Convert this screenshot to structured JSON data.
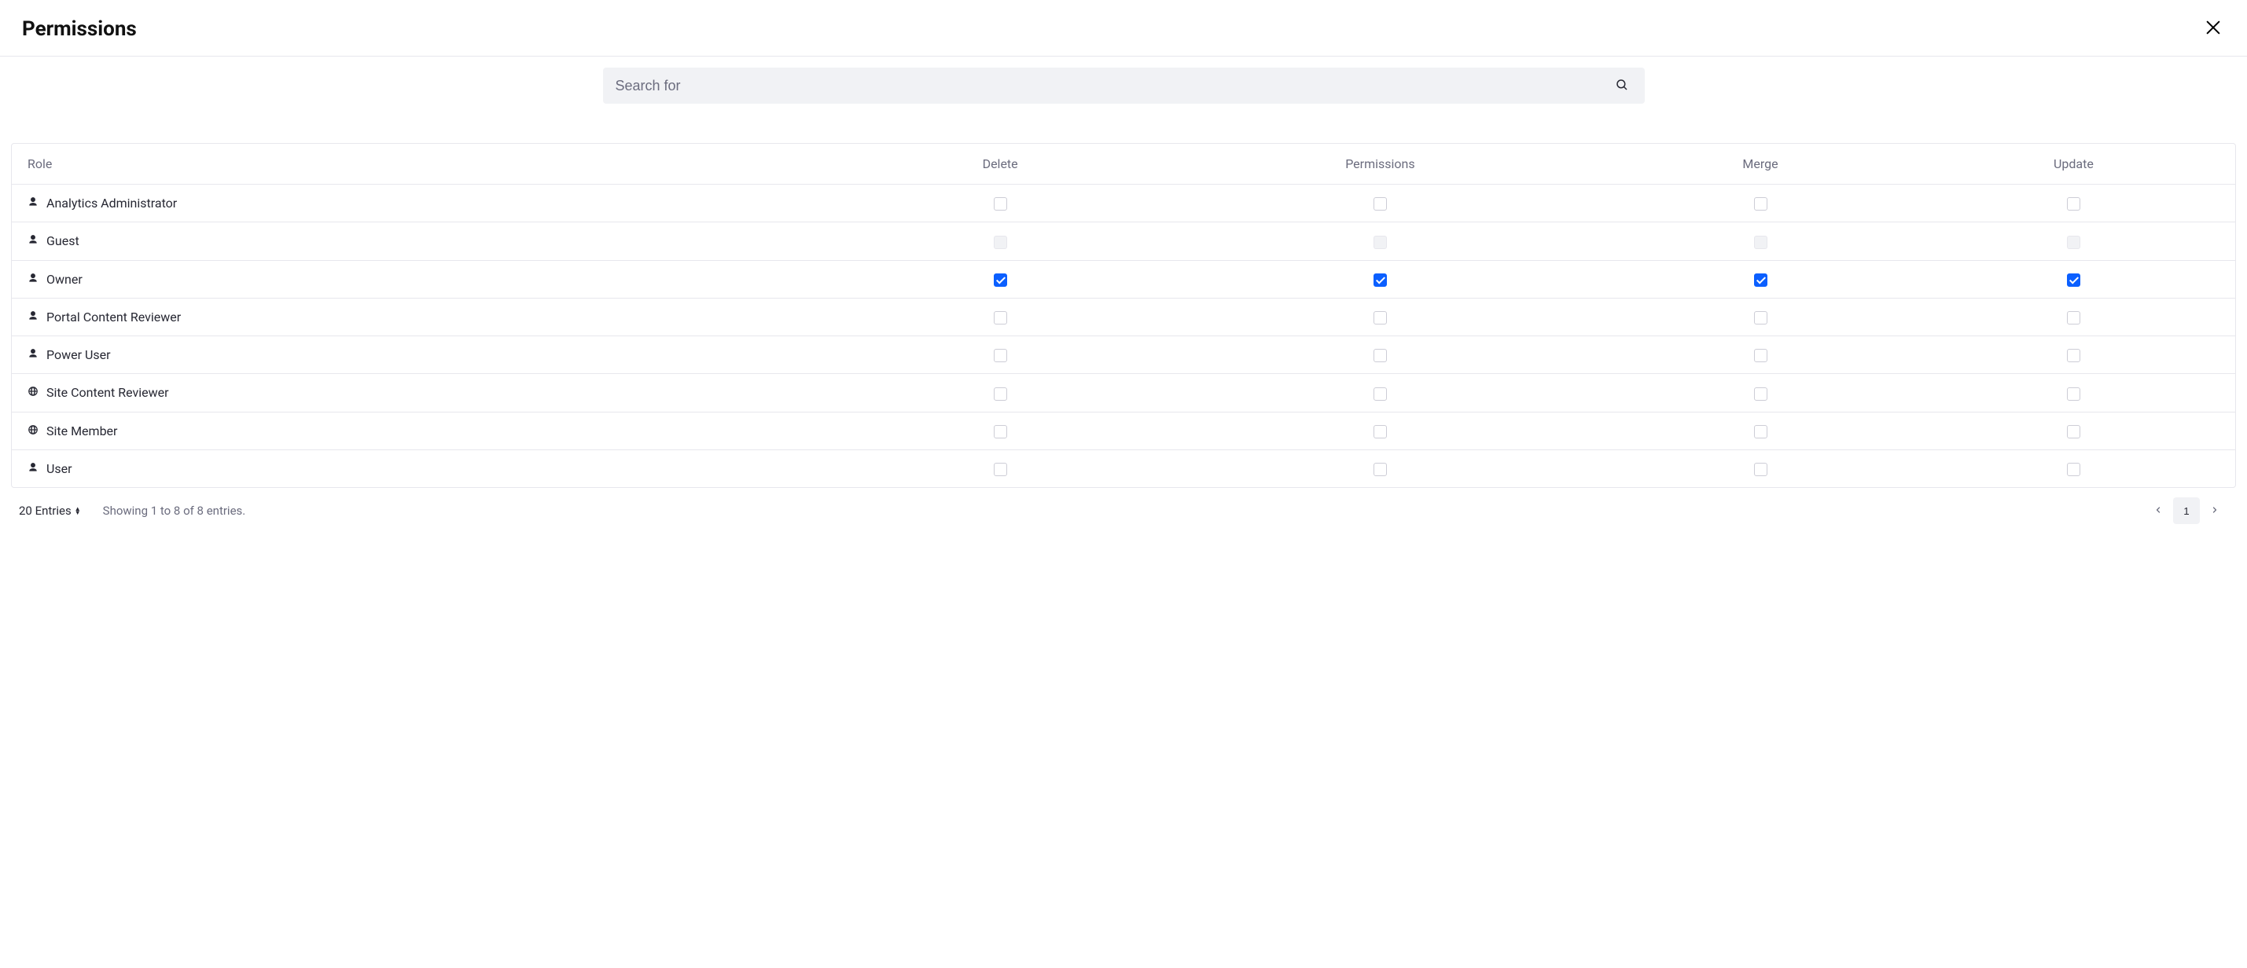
{
  "header": {
    "title": "Permissions"
  },
  "search": {
    "placeholder": "Search for"
  },
  "table": {
    "columns": {
      "role": "Role",
      "delete": "Delete",
      "permissions": "Permissions",
      "merge": "Merge",
      "update": "Update"
    },
    "rows": [
      {
        "name": "Analytics Administrator",
        "icon": "user",
        "disabled": false,
        "delete": false,
        "permissions": false,
        "merge": false,
        "update": false
      },
      {
        "name": "Guest",
        "icon": "user",
        "disabled": true,
        "delete": false,
        "permissions": false,
        "merge": false,
        "update": false
      },
      {
        "name": "Owner",
        "icon": "user",
        "disabled": false,
        "delete": true,
        "permissions": true,
        "merge": true,
        "update": true
      },
      {
        "name": "Portal Content Reviewer",
        "icon": "user",
        "disabled": false,
        "delete": false,
        "permissions": false,
        "merge": false,
        "update": false
      },
      {
        "name": "Power User",
        "icon": "user",
        "disabled": false,
        "delete": false,
        "permissions": false,
        "merge": false,
        "update": false
      },
      {
        "name": "Site Content Reviewer",
        "icon": "globe",
        "disabled": false,
        "delete": false,
        "permissions": false,
        "merge": false,
        "update": false
      },
      {
        "name": "Site Member",
        "icon": "globe",
        "disabled": false,
        "delete": false,
        "permissions": false,
        "merge": false,
        "update": false
      },
      {
        "name": "User",
        "icon": "user",
        "disabled": false,
        "delete": false,
        "permissions": false,
        "merge": false,
        "update": false
      }
    ]
  },
  "footer": {
    "entries_label": "20 Entries",
    "showing": "Showing 1 to 8 of 8 entries.",
    "current_page": "1"
  }
}
